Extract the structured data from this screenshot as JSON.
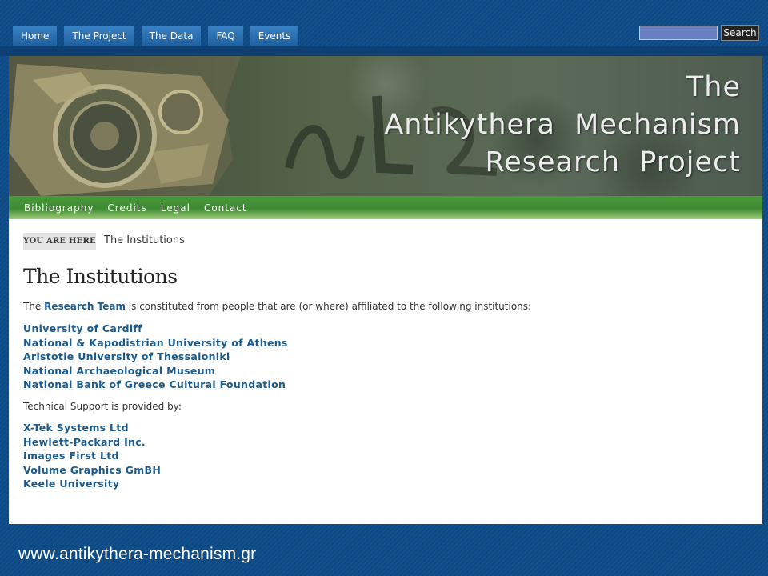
{
  "topnav": {
    "tabs": [
      "Home",
      "The Project",
      "The Data",
      "FAQ",
      "Events"
    ],
    "search_button": "Search",
    "search_value": ""
  },
  "banner": {
    "title_lines": [
      "The",
      "Antikythera  Mechanism",
      "Research  Project"
    ]
  },
  "subnav": {
    "links": [
      "Bibliography",
      "Credits",
      "Legal",
      "Contact"
    ]
  },
  "breadcrumb": {
    "label": "YOU ARE HERE",
    "current": "The Institutions"
  },
  "content": {
    "title": "The Institutions",
    "intro_before": "The ",
    "intro_link": "Research Team",
    "intro_after": " is constituted from people that are (or where) affiliated to the following institutions:",
    "institutions": [
      "University of Cardiff",
      "National & Kapodistrian University of Athens",
      "Aristotle University of Thessaloniki",
      "National Archaeological Museum",
      "National Bank of Greece Cultural Foundation"
    ],
    "support_intro": "Technical Support is provided by:",
    "supporters": [
      "X-Tek Systems Ltd",
      "Hewlett-Packard Inc.",
      "Images First Ltd",
      "Volume Graphics GmBH",
      "Keele University"
    ]
  },
  "footer": {
    "url": "www.antikythera-mechanism.gr"
  },
  "colors": {
    "background": "#0d4a86",
    "tab": "#2a6fb0",
    "link": "#1a5a8c",
    "subnav_green": "#3e8a32"
  }
}
